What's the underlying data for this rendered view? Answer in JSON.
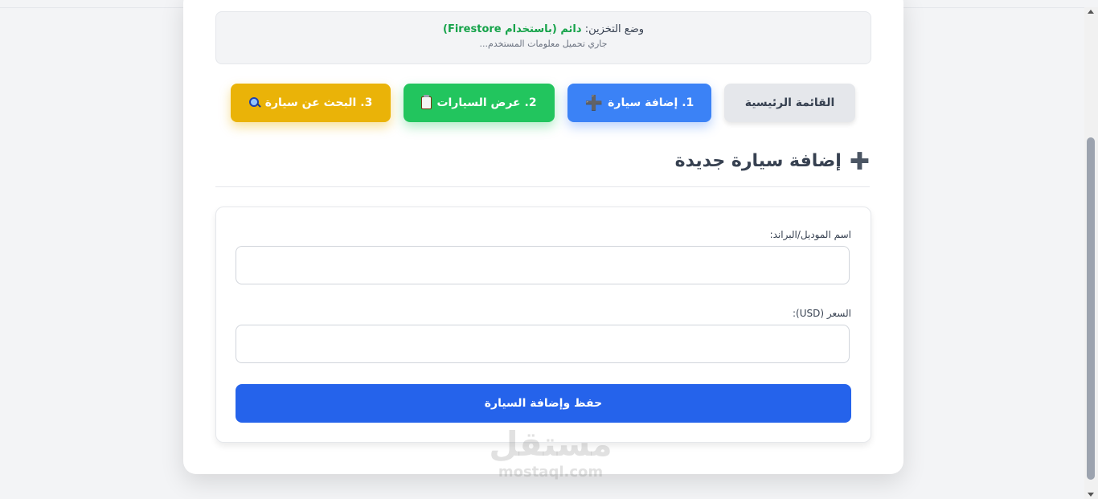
{
  "status": {
    "label": "وضع التخزين:",
    "value": "دائم (باستخدام Firestore)",
    "sub": "جاري تحميل معلومات المستخدم..."
  },
  "nav": {
    "home": "القائمة الرئيسية",
    "add": "1. إضافة سيارة",
    "list": "2. عرض السيارات",
    "search": "3. البحث عن سيارة"
  },
  "section": {
    "title": "إضافة سيارة جديدة"
  },
  "form": {
    "model_label": "اسم الموديل/البراند:",
    "model_value": "",
    "price_label": "السعر (USD):",
    "price_value": "",
    "submit": "حفظ وإضافة السيارة"
  },
  "watermark": {
    "main": "مستقل",
    "sub": "mostaql.com"
  },
  "icons": {
    "add": "plus-icon",
    "list": "clipboard-icon",
    "search": "magnifier-icon"
  },
  "colors": {
    "primary": "#3b82f6",
    "success": "#22c55e",
    "warning": "#eab308",
    "submit": "#2563eb",
    "status_value": "#16a34a"
  }
}
